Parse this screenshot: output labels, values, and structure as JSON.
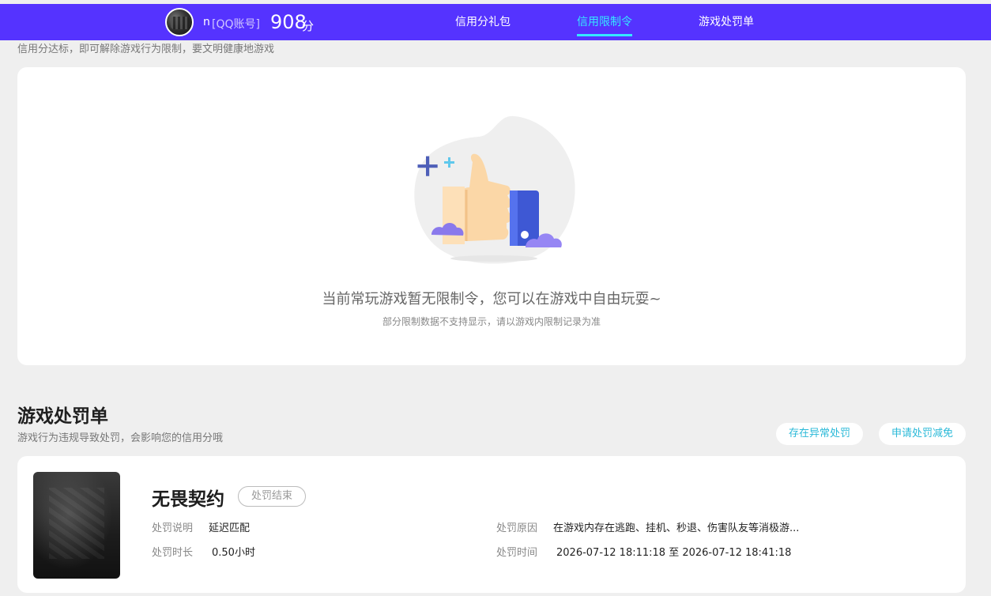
{
  "header": {
    "username": "n",
    "account_type": "[QQ账号]",
    "score": "908",
    "score_unit": "分",
    "tabs": [
      {
        "label": "信用分礼包",
        "active": false
      },
      {
        "label": "信用限制令",
        "active": true
      },
      {
        "label": "游戏处罚单",
        "active": false
      }
    ],
    "colors": {
      "bar": "#5533ff",
      "active_tab": "#35e8ff"
    }
  },
  "restriction": {
    "hint": "信用分达标，即可解除游戏行为限制，要文明健康地游戏",
    "empty_title": "当前常玩游戏暂无限制令，您可以在游戏中自由玩耍~",
    "empty_note": "部分限制数据不支持显示，请以游戏内限制记录为准"
  },
  "punishment": {
    "title": "游戏处罚单",
    "subtitle": "游戏行为违规导致处罚，会影响您的信用分哦",
    "buttons": {
      "abnormal": "存在异常处罚",
      "apply": "申请处罚减免"
    },
    "record": {
      "game_name": "无畏契约",
      "status": "处罚结束",
      "desc_label": "处罚说明",
      "desc_value": "延迟匹配",
      "duration_label": "处罚时长",
      "duration_value": "0.50小时",
      "reason_label": "处罚原因",
      "reason_value": "在游戏内存在逃跑、挂机、秒退、伤害队友等消极游...",
      "time_label": "处罚时间",
      "time_value": "2026-07-12 18:11:18 至 2026-07-12 18:41:18"
    }
  }
}
